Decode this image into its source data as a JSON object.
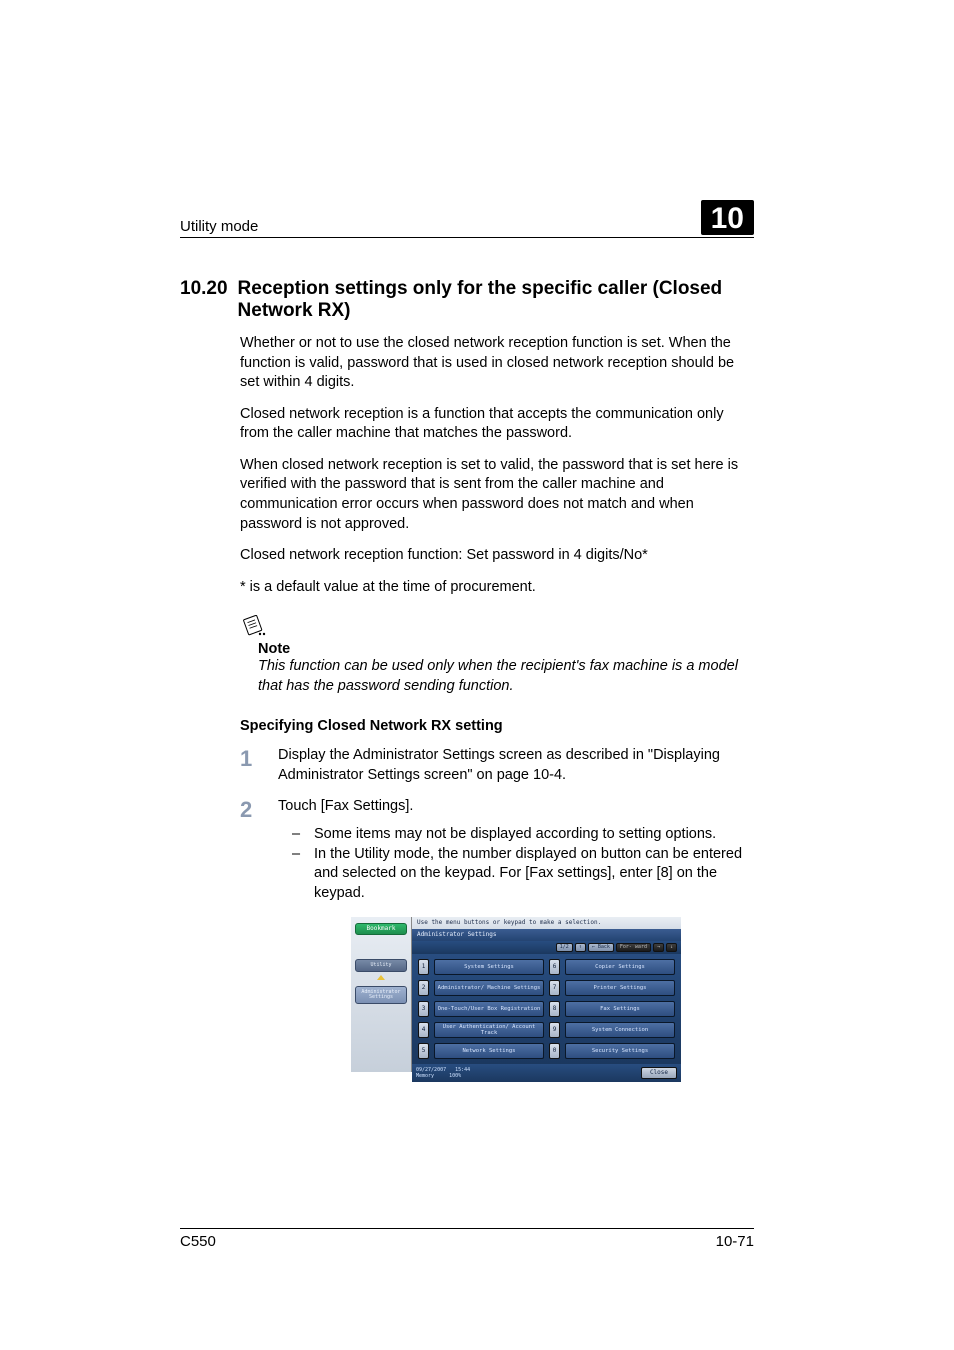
{
  "header": {
    "left": "Utility mode",
    "right": "10"
  },
  "section": {
    "number": "10.20",
    "title": "Reception settings only for the specific caller (Closed Network RX)"
  },
  "paragraphs": {
    "p1": "Whether or not to use the closed network reception function is set. When the function is valid, password that is used in closed network reception should be set within 4 digits.",
    "p2": "Closed network reception is a function that accepts the communication only from the caller machine that matches the password.",
    "p3": "When closed network reception is set to valid, the password that is set here is verified with the password that is sent from the caller machine and communication error occurs when password does not match and when password is not approved.",
    "p4": "Closed network reception function: Set password in 4 digits/No*",
    "p5": "* is a default value at the time of procurement."
  },
  "note": {
    "heading": "Note",
    "body": "This function can be used only when the recipient's fax machine is a model that has the password sending function."
  },
  "subheading": "Specifying Closed Network RX setting",
  "steps": {
    "s1": {
      "num": "1",
      "text": "Display the Administrator Settings screen as described in \"Displaying Administrator Settings screen\" on page 10-4."
    },
    "s2": {
      "num": "2",
      "text": "Touch [Fax Settings].",
      "sub1": "Some items may not be displayed according to setting options.",
      "sub2": "In the Utility mode, the number displayed on button can be entered and selected on the keypad. For [Fax settings], enter [8] on the keypad."
    }
  },
  "panel": {
    "instruction": "Use the menu buttons or keypad to make a selection.",
    "titlebar": "Administrator Settings",
    "left": {
      "bookmark": "Bookmark",
      "utility": "Utility",
      "admin": "Administrator Settings"
    },
    "toolbar": {
      "page": "1/2",
      "back_arrow": "↑",
      "back": "← Back",
      "forward_label": "For- ward",
      "forward_arrow": "→",
      "forward_last": "↓"
    },
    "menu": {
      "n1": "1",
      "b1": "System Settings",
      "n2": "2",
      "b2": "Administrator/ Machine Settings",
      "n3": "3",
      "b3": "One-Touch/User Box Registration",
      "n4": "4",
      "b4": "User Authentication/ Account Track",
      "n5": "5",
      "b5": "Network Settings",
      "n6": "6",
      "b6": "Copier Settings",
      "n7": "7",
      "b7": "Printer Settings",
      "n8": "8",
      "b8": "Fax Settings",
      "n9": "9",
      "b9": "System Connection",
      "n0": "0",
      "b0": "Security Settings"
    },
    "status": {
      "date": "09/27/2007",
      "time": "15:44",
      "mem_label": "Memory",
      "mem_value": "100%",
      "close": "Close"
    }
  },
  "footer": {
    "left": "C550",
    "right": "10-71"
  }
}
